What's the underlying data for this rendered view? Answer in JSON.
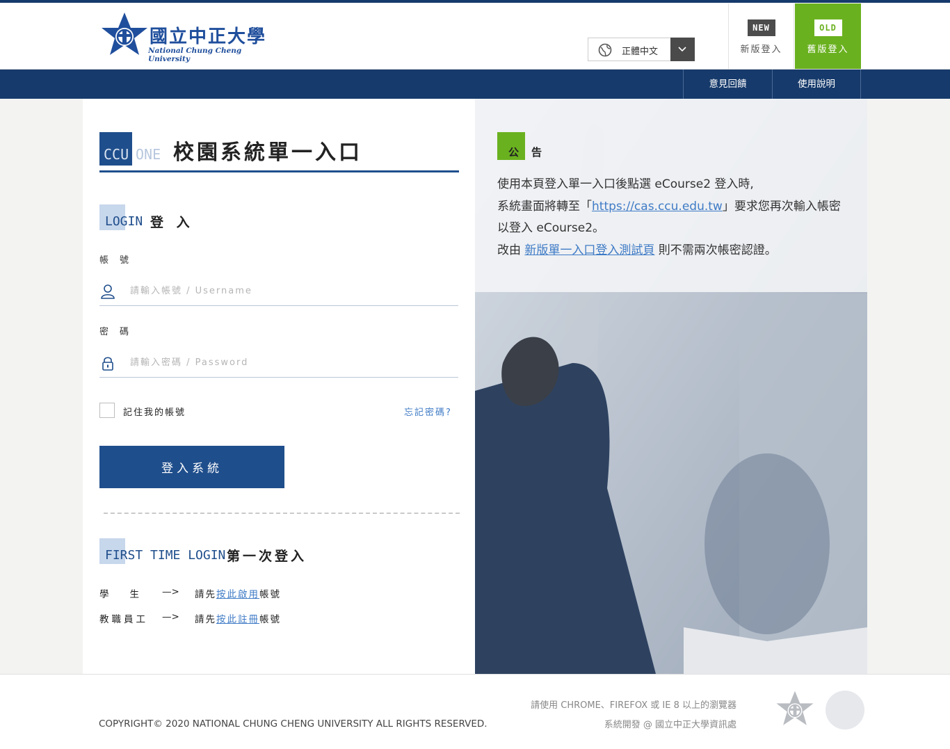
{
  "colors": {
    "primary": "#1f4e8c",
    "navy": "#163a6b",
    "accent_green": "#6ab11f",
    "link": "#3f7bc6"
  },
  "header": {
    "logo_cn": "國立中正大學",
    "logo_en": "National Chung Cheng University",
    "language": {
      "selected": "正體中文",
      "icon": "globe-icon"
    },
    "version_new": {
      "badge": "NEW",
      "label": "新版登入"
    },
    "version_old": {
      "badge": "OLD",
      "label": "舊版登入"
    }
  },
  "nav": {
    "feedback": "意見回饋",
    "help": "使用說明"
  },
  "brand": {
    "ccu": "CCU",
    "one": "ONE",
    "title": "校園系統單一入口"
  },
  "login": {
    "section_en": "LOGIN",
    "section_zh": "登 入",
    "username_label": "帳號",
    "username_placeholder": "請輸入帳號 / Username",
    "username_value": "",
    "password_label": "密碼",
    "password_placeholder": "請輸入密碼 / Password",
    "password_value": "",
    "remember_label": "記住我的帳號",
    "forgot_label": "忘記密碼?",
    "submit_label": "登入系統"
  },
  "first_time": {
    "section_en": "FIRST TIME LOGIN",
    "section_zh": "第一次登入",
    "rows": [
      {
        "who": "學生",
        "arrow": "—>",
        "prefix": "請先",
        "link": "按此啟用",
        "suffix": "帳號"
      },
      {
        "who": "教職員工",
        "arrow": "—>",
        "prefix": "請先",
        "link": "按此註冊",
        "suffix": "帳號"
      }
    ]
  },
  "notice": {
    "title": "公告",
    "line1": "使用本頁登入單一入口後點選 eCourse2 登入時,",
    "line2_pre": "系統畫面將轉至「",
    "line2_link": "https://cas.ccu.edu.tw",
    "line2_post": "」要求您再次輸入帳密",
    "line3": "以登入 eCourse2。",
    "line4_pre": "改由 ",
    "line4_link": "新版單一入口登入測試頁",
    "line4_post": " 則不需兩次帳密認證。"
  },
  "footer": {
    "copyright": "COPYRIGHT© 2020 NATIONAL CHUNG CHENG UNIVERSITY ALL RIGHTS RESERVED.",
    "browser_note": "請使用 CHROME、FIREFOX 或 IE 8 以上的瀏覽器",
    "developer": "系統開發 @ 國立中正大學資訊處"
  }
}
